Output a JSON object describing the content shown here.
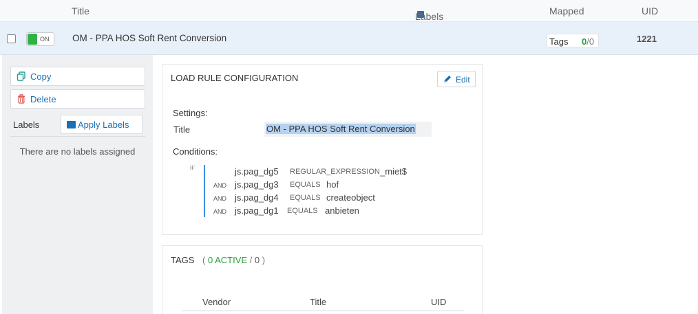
{
  "header": {
    "title_col": "Title",
    "labels_col": "Labels",
    "mapped_col": "Mapped",
    "uid_col": "UID",
    "labels_add_icon": "plus-icon"
  },
  "rule": {
    "toggle_label": "ON",
    "title": "OM - PPA HOS Soft Rent Conversion",
    "tags_label": "Tags",
    "tags_active": "0",
    "tags_sep": "/",
    "tags_total": "0",
    "uid": "1221"
  },
  "left": {
    "copy_label": "Copy",
    "delete_label": "Delete",
    "labels_heading": "Labels",
    "apply_labels": "Apply Labels",
    "no_labels": "There are no labels assigned"
  },
  "config": {
    "heading": "LOAD RULE CONFIGURATION",
    "edit_label": "Edit",
    "settings_heading": "Settings:",
    "title_label": "Title",
    "title_value": "OM - PPA HOS Soft Rent Conversion",
    "conditions_heading": "Conditions:",
    "if_label": "IF",
    "conditions": [
      {
        "joiner": "",
        "variable": "js.pag_dg5",
        "operator": "REGULAR_EXPRESSION",
        "value": "_miet$"
      },
      {
        "joiner": "AND",
        "variable": "js.pag_dg3",
        "operator": "EQUALS",
        "value": "hof"
      },
      {
        "joiner": "AND",
        "variable": "js.pag_dg4",
        "operator": "EQUALS",
        "value": "createobject"
      },
      {
        "joiner": "AND",
        "variable": "js.pag_dg1",
        "operator": "EQUALS",
        "value": "anbieten"
      }
    ]
  },
  "tags": {
    "heading": "TAGS",
    "open_paren": "(",
    "active_text": "0 ACTIVE",
    "slash": "/",
    "total": "0",
    "close_paren": ")",
    "columns": [
      "Vendor",
      "Title",
      "UID"
    ]
  },
  "colors": {
    "accent": "#1a6fb5",
    "on_green": "#2fb344",
    "active_green": "#2a9d3a",
    "row_highlight": "#e8f0fa",
    "selection": "#b5d2f0"
  }
}
